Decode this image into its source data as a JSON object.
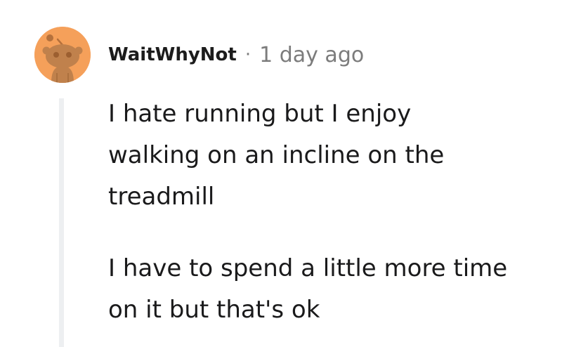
{
  "comment": {
    "username": "WaitWhyNot",
    "separator": "·",
    "timestamp": "1 day ago",
    "avatar_icon": "snoo-avatar-icon",
    "avatar_color": "#f5a05a",
    "paragraphs": [
      "I hate running but I enjoy\nwalking on an incline on the\ntreadmill",
      "I have to spend a little more time\non it but that's ok"
    ]
  }
}
